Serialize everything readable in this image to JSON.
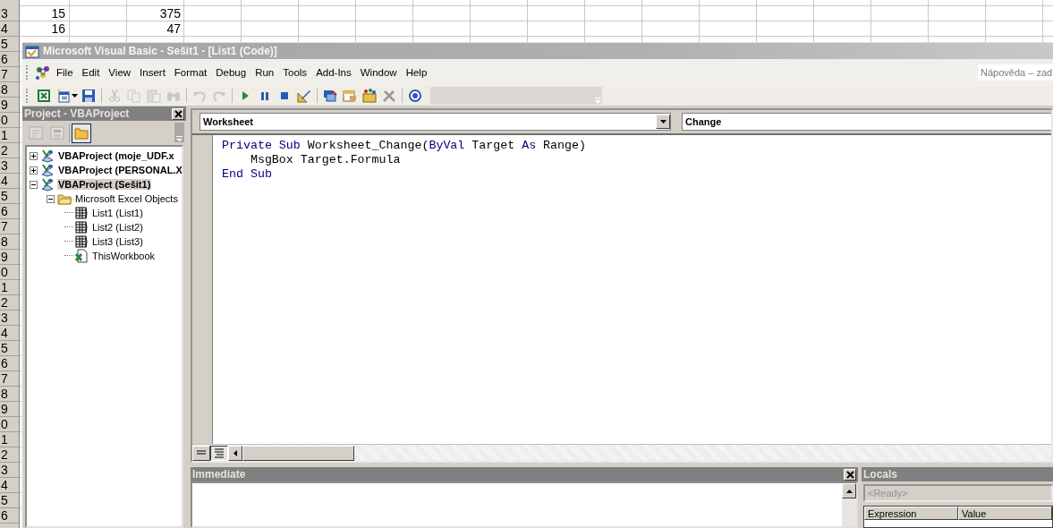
{
  "spreadsheet": {
    "rows": [
      {
        "header": "3",
        "column_1": "15",
        "column_3": "375"
      },
      {
        "header": "4",
        "column_1": "16",
        "column_3": "47"
      },
      {
        "header": "5"
      },
      {
        "header": "6"
      },
      {
        "header": "7"
      },
      {
        "header": "8"
      },
      {
        "header": "9"
      },
      {
        "header": "0"
      },
      {
        "header": "1"
      },
      {
        "header": "2"
      },
      {
        "header": "3"
      },
      {
        "header": "4"
      },
      {
        "header": "5"
      },
      {
        "header": "6"
      },
      {
        "header": "7"
      },
      {
        "header": "8"
      },
      {
        "header": "9"
      },
      {
        "header": "0"
      },
      {
        "header": "1"
      },
      {
        "header": "2"
      },
      {
        "header": "3"
      },
      {
        "header": "4"
      },
      {
        "header": "5"
      },
      {
        "header": "6"
      },
      {
        "header": "7"
      },
      {
        "header": "8"
      },
      {
        "header": "9"
      },
      {
        "header": "0"
      },
      {
        "header": "1"
      },
      {
        "header": "2"
      },
      {
        "header": "3"
      },
      {
        "header": "4"
      },
      {
        "header": "5"
      },
      {
        "header": "6"
      }
    ]
  },
  "window": {
    "title": "Microsoft Visual Basic - Sešit1 - [List1 (Code)]"
  },
  "menu": {
    "items": [
      "File",
      "Edit",
      "View",
      "Insert",
      "Format",
      "Debug",
      "Run",
      "Tools",
      "Add-Ins",
      "Window",
      "Help"
    ],
    "help_box": {
      "placeholder": "Nápověda – zad"
    }
  },
  "toolbar": {
    "items": [
      {
        "kind": "excel",
        "disabled": false
      },
      {
        "kind": "insert",
        "disabled": false
      },
      {
        "kind": "dropdown",
        "disabled": false
      },
      {
        "kind": "save",
        "disabled": false
      },
      {
        "kind": "separator"
      },
      {
        "kind": "cut",
        "disabled": true
      },
      {
        "kind": "copy",
        "disabled": true
      },
      {
        "kind": "paste",
        "disabled": true
      },
      {
        "kind": "find",
        "disabled": true
      },
      {
        "kind": "separator"
      },
      {
        "kind": "undo",
        "disabled": true
      },
      {
        "kind": "redo",
        "disabled": true
      },
      {
        "kind": "separator"
      },
      {
        "kind": "run",
        "disabled": false
      },
      {
        "kind": "pause",
        "disabled": false
      },
      {
        "kind": "stop",
        "disabled": false
      },
      {
        "kind": "design",
        "disabled": false
      },
      {
        "kind": "separator"
      },
      {
        "kind": "project",
        "disabled": false
      },
      {
        "kind": "properties",
        "disabled": false
      },
      {
        "kind": "browser",
        "disabled": false
      },
      {
        "kind": "toolbox",
        "disabled": false
      },
      {
        "kind": "separator"
      },
      {
        "kind": "help",
        "disabled": false
      }
    ]
  },
  "project_pane": {
    "title": "Project - VBAProject",
    "buttons": [
      {
        "kind": "view-code",
        "disabled": true,
        "pressed": false
      },
      {
        "kind": "view-object",
        "disabled": true,
        "pressed": false
      },
      {
        "kind": "toggle-folders",
        "disabled": false,
        "pressed": true
      }
    ],
    "tree": [
      {
        "label": "VBAProject (moje_UDF.x",
        "kind": "project",
        "expanded": false,
        "selected": false
      },
      {
        "label": "VBAProject (PERSONAL.X",
        "kind": "project",
        "expanded": false,
        "selected": false
      },
      {
        "label": "VBAProject (Sešit1)",
        "kind": "project",
        "expanded": true,
        "selected": true,
        "children": [
          {
            "label": "Microsoft Excel Objects",
            "kind": "folder",
            "expanded": true,
            "selected": false,
            "children": [
              {
                "label": "List1 (List1)",
                "kind": "sheet",
                "selected": false
              },
              {
                "label": "List2 (List2)",
                "kind": "sheet",
                "selected": false
              },
              {
                "label": "List3 (List3)",
                "kind": "sheet",
                "selected": false
              },
              {
                "label": "ThisWorkbook",
                "kind": "workbook",
                "selected": false
              }
            ]
          }
        ]
      }
    ]
  },
  "code_window": {
    "object": "Worksheet",
    "procedure": "Change",
    "lines": [
      [
        {
          "text": "Private Sub",
          "kind": "keyword"
        },
        {
          "text": " Worksheet_Change(",
          "kind": "plain"
        },
        {
          "text": "ByVal",
          "kind": "keyword"
        },
        {
          "text": " Target ",
          "kind": "plain"
        },
        {
          "text": "As",
          "kind": "keyword"
        },
        {
          "text": " Range)",
          "kind": "plain"
        }
      ],
      [
        {
          "text": "    MsgBox Target.Formula",
          "kind": "plain"
        }
      ],
      [
        {
          "text": "End Sub",
          "kind": "keyword"
        }
      ]
    ],
    "view_buttons": [
      {
        "kind": "procedure",
        "selected": false
      },
      {
        "kind": "module",
        "selected": true
      }
    ]
  },
  "immediate": {
    "title": "Immediate"
  },
  "locals": {
    "title": "Locals",
    "status": "<Ready>",
    "columns": [
      "Expression",
      "Value"
    ]
  }
}
